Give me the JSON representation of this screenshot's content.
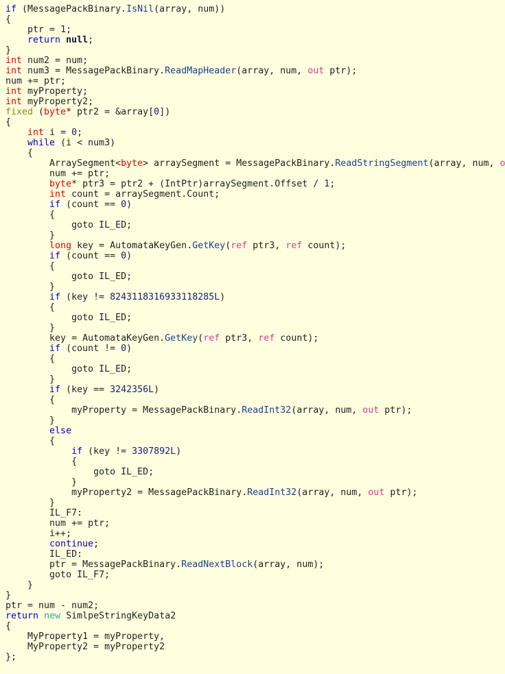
{
  "view": {
    "kind": "code-viewer",
    "language": "C#",
    "background_color": "#FFFFE0",
    "default_text_color": "#202020",
    "font": "monospace",
    "font_size_px": 13.3,
    "line_height_px": 15,
    "tab_size_spaces": 4
  },
  "palette": {
    "keyword": "#0000C0",
    "type_keyword": "#E00000",
    "fixed_keyword": "#8A8A1E",
    "new_keyword": "#35A8A0",
    "modifier": "#E23A8A",
    "method_name": "#1B3F8B",
    "number_literal": "#13236B",
    "null_literal": "#10103A",
    "plain": "#202020"
  },
  "code": {
    "line_count": 65,
    "plain_text": "if (MessagePackBinary.IsNil(array, num))\n{\n    ptr = 1;\n    return null;\n}\nint num2 = num;\nint num3 = MessagePackBinary.ReadMapHeader(array, num, out ptr);\nnum += ptr;\nint myProperty;\nint myProperty2;\nfixed (byte* ptr2 = &array[0])\n{\n    int i = 0;\n    while (i < num3)\n    {\n        ArraySegment<byte> arraySegment = MessagePackBinary.ReadStringSegment(array, num, out ptr);\n        num += ptr;\n        byte* ptr3 = ptr2 + (IntPtr)arraySegment.Offset / 1;\n        int count = arraySegment.Count;\n        if (count == 0)\n        {\n            goto IL_ED;\n        }\n        long key = AutomataKeyGen.GetKey(ref ptr3, ref count);\n        if (count == 0)\n        {\n            goto IL_ED;\n        }\n        if (key != 8243118316933118285L)\n        {\n            goto IL_ED;\n        }\n        key = AutomataKeyGen.GetKey(ref ptr3, ref count);\n        if (count != 0)\n        {\n            goto IL_ED;\n        }\n        if (key == 3242356L)\n        {\n            myProperty = MessagePackBinary.ReadInt32(array, num, out ptr);\n        }\n        else\n        {\n            if (key != 3307892L)\n            {\n                goto IL_ED;\n            }\n            myProperty2 = MessagePackBinary.ReadInt32(array, num, out ptr);\n        }\n        IL_F7:\n        num += ptr;\n        i++;\n        continue;\n        IL_ED:\n        ptr = MessagePackBinary.ReadNextBlock(array, num);\n        goto IL_F7;\n    }\n}\nptr = num - num2;\nreturn new SimlpeStringKeyData2\n{\n    MyProperty1 = myProperty,\n    MyProperty2 = myProperty2\n};",
    "lines": [
      {
        "indent": 0,
        "tokens": [
          {
            "t": "if",
            "c": "kw"
          },
          {
            "t": " (",
            "c": "punct"
          },
          {
            "t": "MessagePackBinary",
            "c": "ident"
          },
          {
            "t": ".",
            "c": "punct"
          },
          {
            "t": "IsNil",
            "c": "method"
          },
          {
            "t": "(array, num))",
            "c": "punct"
          }
        ]
      },
      {
        "indent": 0,
        "tokens": [
          {
            "t": "{",
            "c": "punct"
          }
        ]
      },
      {
        "indent": 4,
        "tokens": [
          {
            "t": "ptr = ",
            "c": "plain"
          },
          {
            "t": "1",
            "c": "num"
          },
          {
            "t": ";",
            "c": "punct"
          }
        ]
      },
      {
        "indent": 4,
        "tokens": [
          {
            "t": "return",
            "c": "kw"
          },
          {
            "t": " ",
            "c": "plain"
          },
          {
            "t": "null",
            "c": "null"
          },
          {
            "t": ";",
            "c": "punct"
          }
        ]
      },
      {
        "indent": 0,
        "tokens": [
          {
            "t": "}",
            "c": "punct"
          }
        ]
      },
      {
        "indent": 0,
        "tokens": [
          {
            "t": "int",
            "c": "type"
          },
          {
            "t": " num2 = num;",
            "c": "plain"
          }
        ]
      },
      {
        "indent": 0,
        "tokens": [
          {
            "t": "int",
            "c": "type"
          },
          {
            "t": " num3 = MessagePackBinary.",
            "c": "plain"
          },
          {
            "t": "ReadMapHeader",
            "c": "method"
          },
          {
            "t": "(array, num, ",
            "c": "plain"
          },
          {
            "t": "out",
            "c": "mod"
          },
          {
            "t": " ptr);",
            "c": "plain"
          }
        ]
      },
      {
        "indent": 0,
        "tokens": [
          {
            "t": "num += ptr;",
            "c": "plain"
          }
        ]
      },
      {
        "indent": 0,
        "tokens": [
          {
            "t": "int",
            "c": "type"
          },
          {
            "t": " myProperty;",
            "c": "plain"
          }
        ]
      },
      {
        "indent": 0,
        "tokens": [
          {
            "t": "int",
            "c": "type"
          },
          {
            "t": " myProperty2;",
            "c": "plain"
          }
        ]
      },
      {
        "indent": 0,
        "tokens": [
          {
            "t": "fixed",
            "c": "fixed"
          },
          {
            "t": " (",
            "c": "plain"
          },
          {
            "t": "byte",
            "c": "type"
          },
          {
            "t": "* ptr2 = &array[",
            "c": "plain"
          },
          {
            "t": "0",
            "c": "num"
          },
          {
            "t": "])",
            "c": "plain"
          }
        ]
      },
      {
        "indent": 0,
        "tokens": [
          {
            "t": "{",
            "c": "punct"
          }
        ]
      },
      {
        "indent": 4,
        "tokens": [
          {
            "t": "int",
            "c": "type"
          },
          {
            "t": " i = ",
            "c": "plain"
          },
          {
            "t": "0",
            "c": "num"
          },
          {
            "t": ";",
            "c": "punct"
          }
        ]
      },
      {
        "indent": 4,
        "tokens": [
          {
            "t": "while",
            "c": "kw"
          },
          {
            "t": " (i < num3)",
            "c": "plain"
          }
        ]
      },
      {
        "indent": 4,
        "tokens": [
          {
            "t": "{",
            "c": "punct"
          }
        ]
      },
      {
        "indent": 8,
        "tokens": [
          {
            "t": "ArraySegment<",
            "c": "plain"
          },
          {
            "t": "byte",
            "c": "type"
          },
          {
            "t": "> arraySegment = MessagePackBinary.",
            "c": "plain"
          },
          {
            "t": "ReadStringSegment",
            "c": "method"
          },
          {
            "t": "(array, num, ",
            "c": "plain"
          },
          {
            "t": "out",
            "c": "mod"
          },
          {
            "t": " ptr);",
            "c": "plain"
          }
        ]
      },
      {
        "indent": 8,
        "tokens": [
          {
            "t": "num += ptr;",
            "c": "plain"
          }
        ]
      },
      {
        "indent": 8,
        "tokens": [
          {
            "t": "byte",
            "c": "type"
          },
          {
            "t": "* ptr3 = ptr2 + (IntPtr)arraySegment.Offset / ",
            "c": "plain"
          },
          {
            "t": "1",
            "c": "num"
          },
          {
            "t": ";",
            "c": "punct"
          }
        ]
      },
      {
        "indent": 8,
        "tokens": [
          {
            "t": "int",
            "c": "type"
          },
          {
            "t": " count = arraySegment.Count;",
            "c": "plain"
          }
        ]
      },
      {
        "indent": 8,
        "tokens": [
          {
            "t": "if",
            "c": "kw"
          },
          {
            "t": " (count == ",
            "c": "plain"
          },
          {
            "t": "0",
            "c": "num"
          },
          {
            "t": ")",
            "c": "plain"
          }
        ]
      },
      {
        "indent": 8,
        "tokens": [
          {
            "t": "{",
            "c": "punct"
          }
        ]
      },
      {
        "indent": 12,
        "tokens": [
          {
            "t": "goto IL_ED;",
            "c": "plain"
          }
        ]
      },
      {
        "indent": 8,
        "tokens": [
          {
            "t": "}",
            "c": "punct"
          }
        ]
      },
      {
        "indent": 8,
        "tokens": [
          {
            "t": "long",
            "c": "type"
          },
          {
            "t": " key = AutomataKeyGen.",
            "c": "plain"
          },
          {
            "t": "GetKey",
            "c": "method"
          },
          {
            "t": "(",
            "c": "plain"
          },
          {
            "t": "ref",
            "c": "mod"
          },
          {
            "t": " ptr3, ",
            "c": "plain"
          },
          {
            "t": "ref",
            "c": "mod"
          },
          {
            "t": " count);",
            "c": "plain"
          }
        ]
      },
      {
        "indent": 8,
        "tokens": [
          {
            "t": "if",
            "c": "kw"
          },
          {
            "t": " (count == ",
            "c": "plain"
          },
          {
            "t": "0",
            "c": "num"
          },
          {
            "t": ")",
            "c": "plain"
          }
        ]
      },
      {
        "indent": 8,
        "tokens": [
          {
            "t": "{",
            "c": "punct"
          }
        ]
      },
      {
        "indent": 12,
        "tokens": [
          {
            "t": "goto IL_ED;",
            "c": "plain"
          }
        ]
      },
      {
        "indent": 8,
        "tokens": [
          {
            "t": "}",
            "c": "punct"
          }
        ]
      },
      {
        "indent": 8,
        "tokens": [
          {
            "t": "if",
            "c": "kw"
          },
          {
            "t": " (key != ",
            "c": "plain"
          },
          {
            "t": "8243118316933118285L",
            "c": "num"
          },
          {
            "t": ")",
            "c": "plain"
          }
        ]
      },
      {
        "indent": 8,
        "tokens": [
          {
            "t": "{",
            "c": "punct"
          }
        ]
      },
      {
        "indent": 12,
        "tokens": [
          {
            "t": "goto IL_ED;",
            "c": "plain"
          }
        ]
      },
      {
        "indent": 8,
        "tokens": [
          {
            "t": "}",
            "c": "punct"
          }
        ]
      },
      {
        "indent": 8,
        "tokens": [
          {
            "t": "key = AutomataKeyGen.",
            "c": "plain"
          },
          {
            "t": "GetKey",
            "c": "method"
          },
          {
            "t": "(",
            "c": "plain"
          },
          {
            "t": "ref",
            "c": "mod"
          },
          {
            "t": " ptr3, ",
            "c": "plain"
          },
          {
            "t": "ref",
            "c": "mod"
          },
          {
            "t": " count);",
            "c": "plain"
          }
        ]
      },
      {
        "indent": 8,
        "tokens": [
          {
            "t": "if",
            "c": "kw"
          },
          {
            "t": " (count != ",
            "c": "plain"
          },
          {
            "t": "0",
            "c": "num"
          },
          {
            "t": ")",
            "c": "plain"
          }
        ]
      },
      {
        "indent": 8,
        "tokens": [
          {
            "t": "{",
            "c": "punct"
          }
        ]
      },
      {
        "indent": 12,
        "tokens": [
          {
            "t": "goto IL_ED;",
            "c": "plain"
          }
        ]
      },
      {
        "indent": 8,
        "tokens": [
          {
            "t": "}",
            "c": "punct"
          }
        ]
      },
      {
        "indent": 8,
        "tokens": [
          {
            "t": "if",
            "c": "kw"
          },
          {
            "t": " (key == ",
            "c": "plain"
          },
          {
            "t": "3242356L",
            "c": "num"
          },
          {
            "t": ")",
            "c": "plain"
          }
        ]
      },
      {
        "indent": 8,
        "tokens": [
          {
            "t": "{",
            "c": "punct"
          }
        ]
      },
      {
        "indent": 12,
        "tokens": [
          {
            "t": "myProperty = MessagePackBinary.",
            "c": "plain"
          },
          {
            "t": "ReadInt32",
            "c": "method"
          },
          {
            "t": "(array, num, ",
            "c": "plain"
          },
          {
            "t": "out",
            "c": "mod"
          },
          {
            "t": " ptr);",
            "c": "plain"
          }
        ]
      },
      {
        "indent": 8,
        "tokens": [
          {
            "t": "}",
            "c": "punct"
          }
        ]
      },
      {
        "indent": 8,
        "tokens": [
          {
            "t": "else",
            "c": "kw"
          }
        ]
      },
      {
        "indent": 8,
        "tokens": [
          {
            "t": "{",
            "c": "punct"
          }
        ]
      },
      {
        "indent": 12,
        "tokens": [
          {
            "t": "if",
            "c": "kw"
          },
          {
            "t": " (key != ",
            "c": "plain"
          },
          {
            "t": "3307892L",
            "c": "num"
          },
          {
            "t": ")",
            "c": "plain"
          }
        ]
      },
      {
        "indent": 12,
        "tokens": [
          {
            "t": "{",
            "c": "punct"
          }
        ]
      },
      {
        "indent": 16,
        "tokens": [
          {
            "t": "goto IL_ED;",
            "c": "plain"
          }
        ]
      },
      {
        "indent": 12,
        "tokens": [
          {
            "t": "}",
            "c": "punct"
          }
        ]
      },
      {
        "indent": 12,
        "tokens": [
          {
            "t": "myProperty2 = MessagePackBinary.",
            "c": "plain"
          },
          {
            "t": "ReadInt32",
            "c": "method"
          },
          {
            "t": "(array, num, ",
            "c": "plain"
          },
          {
            "t": "out",
            "c": "mod"
          },
          {
            "t": " ptr);",
            "c": "plain"
          }
        ]
      },
      {
        "indent": 8,
        "tokens": [
          {
            "t": "}",
            "c": "punct"
          }
        ]
      },
      {
        "indent": 8,
        "tokens": [
          {
            "t": "IL_F7:",
            "c": "plain"
          }
        ]
      },
      {
        "indent": 8,
        "tokens": [
          {
            "t": "num += ptr;",
            "c": "plain"
          }
        ]
      },
      {
        "indent": 8,
        "tokens": [
          {
            "t": "i++;",
            "c": "plain"
          }
        ]
      },
      {
        "indent": 8,
        "tokens": [
          {
            "t": "continue",
            "c": "kw"
          },
          {
            "t": ";",
            "c": "punct"
          }
        ]
      },
      {
        "indent": 8,
        "tokens": [
          {
            "t": "IL_ED:",
            "c": "plain"
          }
        ]
      },
      {
        "indent": 8,
        "tokens": [
          {
            "t": "ptr = MessagePackBinary.",
            "c": "plain"
          },
          {
            "t": "ReadNextBlock",
            "c": "method"
          },
          {
            "t": "(array, num);",
            "c": "plain"
          }
        ]
      },
      {
        "indent": 8,
        "tokens": [
          {
            "t": "goto IL_F7;",
            "c": "plain"
          }
        ]
      },
      {
        "indent": 4,
        "tokens": [
          {
            "t": "}",
            "c": "punct"
          }
        ]
      },
      {
        "indent": 0,
        "tokens": [
          {
            "t": "}",
            "c": "punct"
          }
        ]
      },
      {
        "indent": 0,
        "tokens": [
          {
            "t": "ptr = num - num2;",
            "c": "plain"
          }
        ]
      },
      {
        "indent": 0,
        "tokens": [
          {
            "t": "return",
            "c": "kw"
          },
          {
            "t": " ",
            "c": "plain"
          },
          {
            "t": "new",
            "c": "new"
          },
          {
            "t": " SimlpeStringKeyData2",
            "c": "plain"
          }
        ]
      },
      {
        "indent": 0,
        "tokens": [
          {
            "t": "{",
            "c": "punct"
          }
        ]
      },
      {
        "indent": 4,
        "tokens": [
          {
            "t": "MyProperty1 = myProperty,",
            "c": "plain"
          }
        ]
      },
      {
        "indent": 4,
        "tokens": [
          {
            "t": "MyProperty2 = myProperty2",
            "c": "plain"
          }
        ]
      },
      {
        "indent": 0,
        "tokens": [
          {
            "t": "};",
            "c": "punct"
          }
        ]
      }
    ]
  }
}
